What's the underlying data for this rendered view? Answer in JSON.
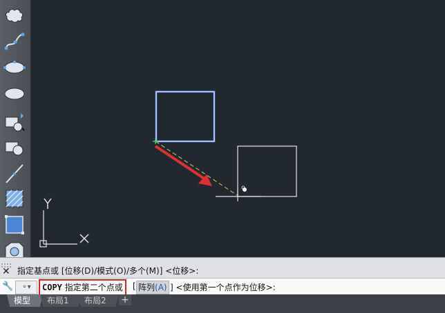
{
  "toolbar": {
    "tools": [
      {
        "name": "revision-cloud-icon"
      },
      {
        "name": "spline-icon"
      },
      {
        "name": "ellipse-icon"
      },
      {
        "name": "ellipse-arc-icon"
      },
      {
        "name": "insert-block-icon"
      },
      {
        "name": "make-block-icon"
      },
      {
        "name": "point-icon"
      },
      {
        "name": "hatch-icon"
      },
      {
        "name": "region-icon"
      },
      {
        "name": "table-icon"
      }
    ]
  },
  "canvas": {
    "ucs": {
      "x_label": "X",
      "y_label": "Y"
    },
    "colors": {
      "background": "#212830",
      "selected_rect": "#6f9cff",
      "arrow": "#e03030",
      "rubberband": "#c8b040",
      "geometry": "#e6e6e6"
    }
  },
  "command": {
    "history": "指定基点或 [位移(D)/模式(O)/多个(M)] <位移>:",
    "command_name": "COPY",
    "prompt": "指定第二个点或",
    "option_bracket_open": "[",
    "option_label": "阵列",
    "option_key": "(A)",
    "option_bracket_close": "]",
    "rest": "<使用第一个点作为位移>:",
    "prompt_button": "⚬▾"
  },
  "tabs": [
    {
      "label": "模型"
    },
    {
      "label": "布局1"
    },
    {
      "label": "布局2"
    }
  ],
  "tab_add": "+"
}
